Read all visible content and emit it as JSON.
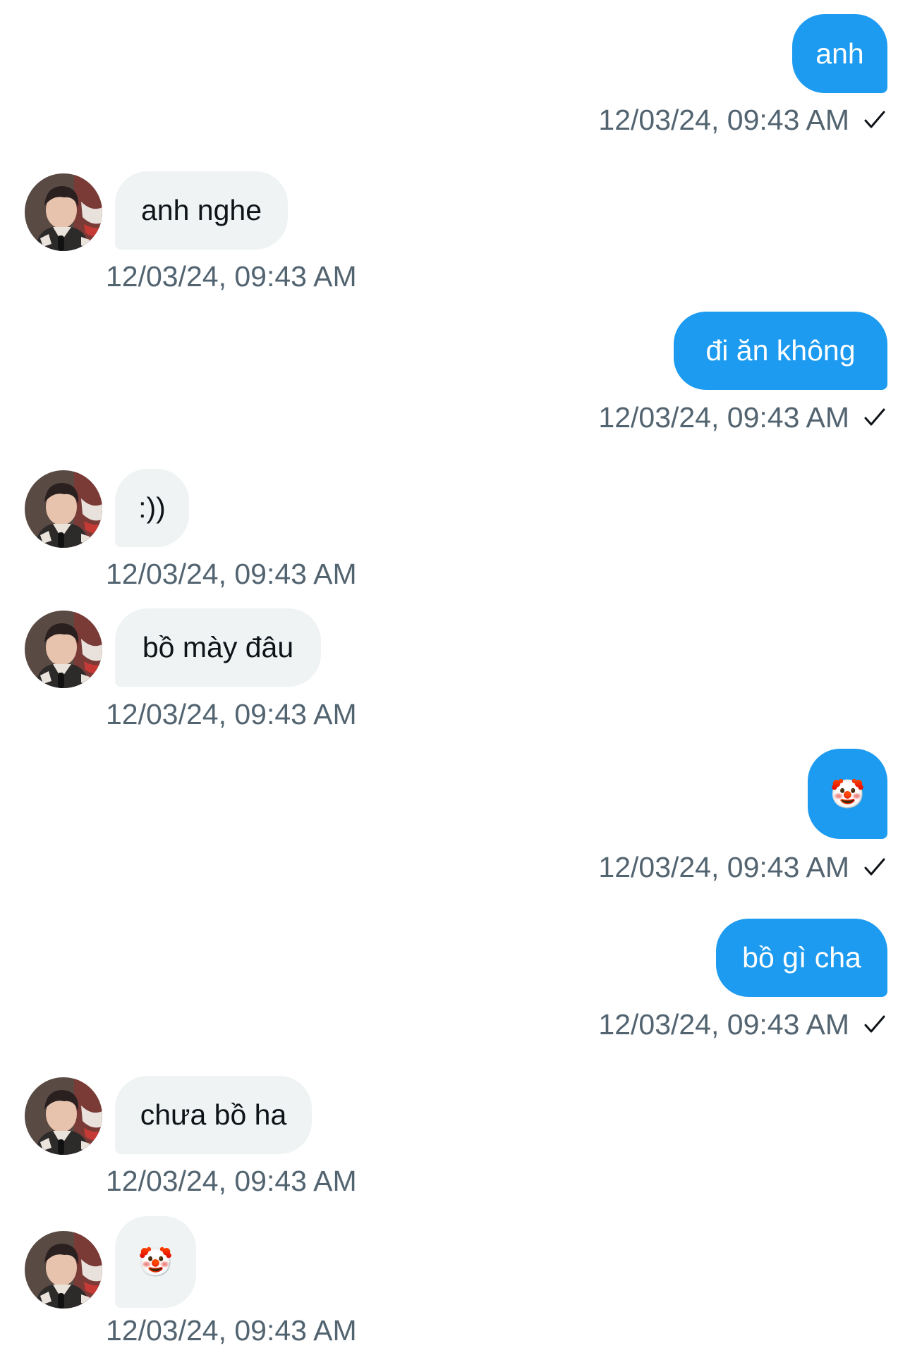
{
  "messages": [
    {
      "dir": "out",
      "text": "anh",
      "time": "12/03/24, 09:43 AM"
    },
    {
      "dir": "in",
      "text": "anh nghe",
      "time": "12/03/24, 09:43 AM"
    },
    {
      "dir": "out",
      "text": "đi ăn không",
      "time": "12/03/24, 09:43 AM"
    },
    {
      "dir": "in",
      "text": ":))",
      "time": "12/03/24, 09:43 AM"
    },
    {
      "dir": "in",
      "text": "bồ mày đâu",
      "time": "12/03/24, 09:43 AM"
    },
    {
      "dir": "out",
      "text": "🤡",
      "time": "12/03/24, 09:43 AM"
    },
    {
      "dir": "out",
      "text": "bồ gì cha",
      "time": "12/03/24, 09:43 AM"
    },
    {
      "dir": "in",
      "text": "chưa bồ ha",
      "time": "12/03/24, 09:43 AM"
    },
    {
      "dir": "in",
      "text": "🤡",
      "time": "12/03/24, 09:43 AM"
    }
  ],
  "icons": {
    "sent_status": "check-icon",
    "contact_avatar": "avatar"
  },
  "colors": {
    "outgoing_bubble": "#1d9bf0",
    "incoming_bubble": "#eff3f4",
    "timestamp": "#536471"
  }
}
